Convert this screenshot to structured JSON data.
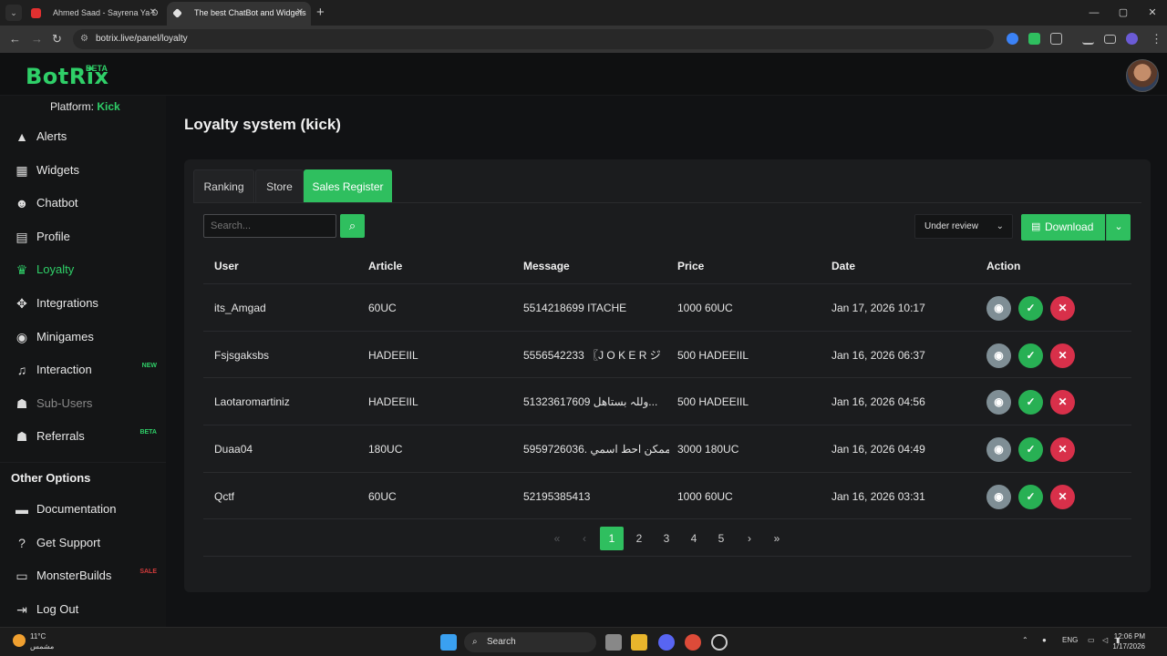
{
  "browser": {
    "tabs": [
      {
        "title": "Ahmed Saad - Sayrena Ya D",
        "favicon_color": "#e23030"
      },
      {
        "title": "The best ChatBot and Widgets",
        "favicon_color": "#e0e0e0"
      }
    ],
    "url": "botrix.live/panel/loyalty",
    "window_controls": [
      "—",
      "▢",
      "✕"
    ]
  },
  "app": {
    "logo": "BotRix",
    "logo_badge": "BETA",
    "platform_label": "Platform:",
    "platform_value": "Kick",
    "accent": "#2fbf5f"
  },
  "sidebar": {
    "items": [
      {
        "label": "Alerts",
        "icon": "warning-icon",
        "glyph": "▲"
      },
      {
        "label": "Widgets",
        "icon": "grid-icon",
        "glyph": "▦"
      },
      {
        "label": "Chatbot",
        "icon": "robot-icon",
        "glyph": "☻"
      },
      {
        "label": "Profile",
        "icon": "id-card-icon",
        "glyph": "▤"
      },
      {
        "label": "Loyalty",
        "icon": "trophy-icon",
        "glyph": "♛",
        "active": true
      },
      {
        "label": "Integrations",
        "icon": "puzzle-icon",
        "glyph": "✥"
      },
      {
        "label": "Minigames",
        "icon": "gamepad-icon",
        "glyph": "◉"
      },
      {
        "label": "Interaction",
        "icon": "music-icon",
        "glyph": "♫",
        "badge": "NEW"
      },
      {
        "label": "Sub-Users",
        "icon": "users-icon",
        "glyph": "☗",
        "disabled": true
      },
      {
        "label": "Referrals",
        "icon": "users-icon",
        "glyph": "☗",
        "badge": "BETA"
      }
    ],
    "other_options_title": "Other Options",
    "other_items": [
      {
        "label": "Documentation",
        "icon": "book-icon",
        "glyph": "▬"
      },
      {
        "label": "Get Support",
        "icon": "question-icon",
        "glyph": "?"
      },
      {
        "label": "MonsterBuilds",
        "icon": "monitor-icon",
        "glyph": "▭",
        "badge": "SALE"
      },
      {
        "label": "Log Out",
        "icon": "logout-icon",
        "glyph": "⇥"
      }
    ]
  },
  "main": {
    "title": "Loyalty system (kick)",
    "tabs": [
      "Ranking",
      "Store",
      "Sales Register"
    ],
    "active_tab": "Sales Register",
    "search_placeholder": "Search...",
    "filter_value": "Under review",
    "download_label": "Download",
    "columns": [
      "User",
      "Article",
      "Message",
      "Price",
      "Date",
      "Action"
    ],
    "rows": [
      {
        "user": "its_Amgad",
        "article": "60UC",
        "message": "5514218699 ITACHE",
        "price": "1000 60UC",
        "date": "Jan 17, 2026 10:17"
      },
      {
        "user": "Fsjsgaksbs",
        "article": "HADEEIIL",
        "message": "5556542233 〖J O K E R ジ",
        "price": "500 HADEEIIL",
        "date": "Jan 16, 2026 06:37"
      },
      {
        "user": "Laotaromartiniz",
        "article": "HADEEIIL",
        "message": "51323617609 وللہ بستاهل...",
        "price": "500 HADEEIIL",
        "date": "Jan 16, 2026 04:56"
      },
      {
        "user": "Duaa04",
        "article": "180UC",
        "message": "5959726036. ممكن احط اسمي...",
        "price": "3000 180UC",
        "date": "Jan 16, 2026 04:49"
      },
      {
        "user": "Qctf",
        "article": "60UC",
        "message": "52195385413",
        "price": "1000 60UC",
        "date": "Jan 16, 2026 03:31"
      }
    ],
    "pagination": {
      "first": "«",
      "prev": "‹",
      "pages": [
        "1",
        "2",
        "3",
        "4",
        "5"
      ],
      "current": "1",
      "next": "›",
      "last": "»"
    }
  },
  "taskbar": {
    "weather_temp": "11°C",
    "weather_desc": "مشمس",
    "search_label": "Search",
    "lang": "ENG",
    "time": "12:06 PM",
    "date": "1/17/2026"
  }
}
